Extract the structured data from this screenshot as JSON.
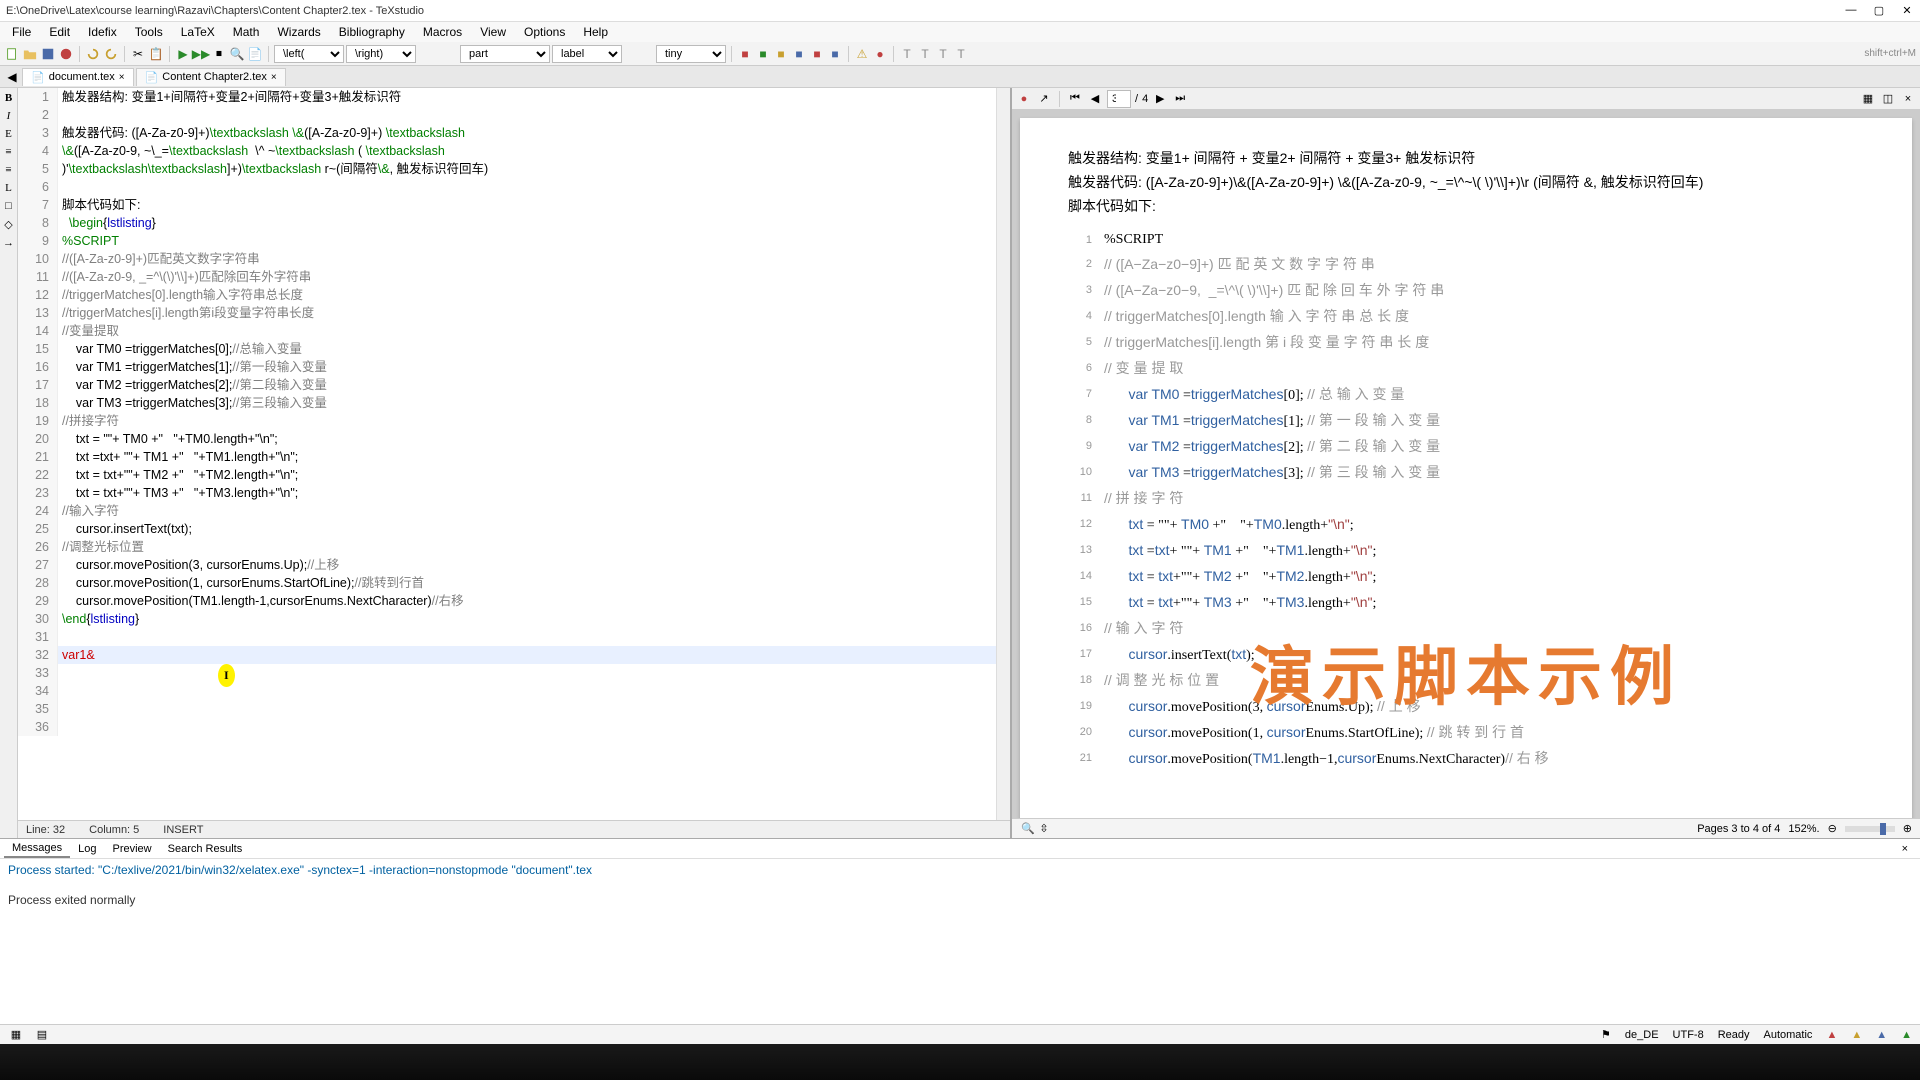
{
  "title": "E:\\OneDrive\\Latex\\course learning\\Razavi\\Chapters\\Content Chapter2.tex - TeXstudio",
  "menus": [
    "File",
    "Edit",
    "Idefix",
    "Tools",
    "LaTeX",
    "Math",
    "Wizards",
    "Bibliography",
    "Macros",
    "View",
    "Options",
    "Help"
  ],
  "combos": {
    "left": "\\left(",
    "right": "\\right)",
    "part": "part",
    "label": "label",
    "tiny": "tiny"
  },
  "tabs": [
    {
      "label": "document.tex"
    },
    {
      "label": "Content Chapter2.tex"
    }
  ],
  "side": [
    "B",
    "I",
    "E",
    "≡",
    "≡",
    "L",
    "□",
    "◇",
    "→"
  ],
  "lines": [
    {
      "n": 1,
      "t": "触发器结构: 变量1+间隔符+变量2+间隔符+变量3+触发标识符"
    },
    {
      "n": 2,
      "t": ""
    },
    {
      "n": 3,
      "t": "触发器代码: ([A-Za-z0-9]+)\\textbackslash \\&([A-Za-z0-9]+) \\textbackslash"
    },
    {
      "n": 4,
      "t": "\\&([A-Za-z0-9, ~\\_=\\textbackslash  \\^ ~\\textbackslash ( \\textbackslash"
    },
    {
      "n": 5,
      "t": ")'\\textbackslash\\textbackslash]+)\\textbackslash r~(间隔符\\&, 触发标识符回车)"
    },
    {
      "n": 6,
      "t": ""
    },
    {
      "n": 7,
      "t": "脚本代码如下:"
    },
    {
      "n": 8,
      "t": "  \\begin{lstlisting}",
      "env": true
    },
    {
      "n": 9,
      "t": "%SCRIPT",
      "c": "green"
    },
    {
      "n": 10,
      "t": "//([A-Za-z0-9]+)匹配英文数字字符串",
      "c": "gray"
    },
    {
      "n": 11,
      "t": "//([A-Za-z0-9, _=^\\(\\)'\\\\]+)匹配除回车外字符串",
      "c": "gray"
    },
    {
      "n": 12,
      "t": "//triggerMatches[0].length输入字符串总长度",
      "c": "gray"
    },
    {
      "n": 13,
      "t": "//triggerMatches[i].length第i段变量字符串长度",
      "c": "gray"
    },
    {
      "n": 14,
      "t": "//变量提取",
      "c": "gray"
    },
    {
      "n": 15,
      "t": "    var TM0 =triggerMatches[0];//总输入变量",
      "c": "mix"
    },
    {
      "n": 16,
      "t": "    var TM1 =triggerMatches[1];//第一段输入变量",
      "c": "mix"
    },
    {
      "n": 17,
      "t": "    var TM2 =triggerMatches[2];//第二段输入变量",
      "c": "mix"
    },
    {
      "n": 18,
      "t": "    var TM3 =triggerMatches[3];//第三段输入变量",
      "c": "mix"
    },
    {
      "n": 19,
      "t": "//拼接字符",
      "c": "gray"
    },
    {
      "n": 20,
      "t": "    txt = \"\"+ TM0 +\"   \"+TM0.length+\"\\n\";",
      "c": "mix"
    },
    {
      "n": 21,
      "t": "    txt =txt+ \"\"+ TM1 +\"   \"+TM1.length+\"\\n\";",
      "c": "mix"
    },
    {
      "n": 22,
      "t": "    txt = txt+\"\"+ TM2 +\"   \"+TM2.length+\"\\n\";",
      "c": "mix"
    },
    {
      "n": 23,
      "t": "    txt = txt+\"\"+ TM3 +\"   \"+TM3.length+\"\\n\";",
      "c": "mix"
    },
    {
      "n": 24,
      "t": "//输入字符",
      "c": "gray"
    },
    {
      "n": 25,
      "t": "    cursor.insertText(txt);",
      "c": "mix"
    },
    {
      "n": 26,
      "t": "//调整光标位置",
      "c": "gray"
    },
    {
      "n": 27,
      "t": "    cursor.movePosition(3, cursorEnums.Up);//上移",
      "c": "mix"
    },
    {
      "n": 28,
      "t": "    cursor.movePosition(1, cursorEnums.StartOfLine);//跳转到行首",
      "c": "mix"
    },
    {
      "n": 29,
      "t": "    cursor.movePosition(TM1.length-1,cursorEnums.NextCharacter)//右移",
      "c": "mix"
    },
    {
      "n": 30,
      "t": "\\end{lstlisting}",
      "env": true
    },
    {
      "n": 31,
      "t": ""
    },
    {
      "n": 32,
      "t": "var1&",
      "cur": true,
      "red": true
    },
    {
      "n": 33,
      "t": ""
    },
    {
      "n": 34,
      "t": ""
    },
    {
      "n": 35,
      "t": ""
    },
    {
      "n": 36,
      "t": ""
    }
  ],
  "status": {
    "line": "Line: 32",
    "col": "Column: 5",
    "mode": "INSERT"
  },
  "bptabs": [
    "Messages",
    "Log",
    "Preview",
    "Search Results"
  ],
  "bplog1": "Process started: \"C:/texlive/2021/bin/win32/xelatex.exe\" -synctex=1 -interaction=nonstopmode \"document\".tex",
  "bplog2": "Process exited normally",
  "pv": {
    "nav": {
      "cur": "3",
      "sep": "/",
      "tot": "4"
    },
    "header": [
      "触发器结构: 变量1+ 间隔符 + 变量2+ 间隔符 + 变量3+ 触发标识符",
      "触发器代码: ([A-Za-z0-9]+)\\&([A-Za-z0-9]+) \\&([A-Za-z0-9, ~_=\\^~\\( \\)'\\\\]+)\\r (间隔符 &, 触发标识符回车)",
      "脚本代码如下:"
    ],
    "plines": [
      {
        "n": 1,
        "t": "%SCRIPT"
      },
      {
        "n": 2,
        "t": "// ([A−Za−z0−9]+) 匹 配 英 文 数 字 字 符 串",
        "c": 1
      },
      {
        "n": 3,
        "t": "// ([A−Za−z0−9,  _=\\^\\( \\)'\\\\]+) 匹 配 除 回 车 外 字 符 串",
        "c": 1
      },
      {
        "n": 4,
        "t": "// triggerMatches[0].length 输 入 字 符 串 总 长 度",
        "c": 1
      },
      {
        "n": 5,
        "t": "// triggerMatches[i].length 第 i 段 变 量 字 符 串 长 度",
        "c": 1
      },
      {
        "n": 6,
        "t": "// 变 量 提 取",
        "c": 1
      },
      {
        "n": 7,
        "t": "       var TM0 =triggerMatches[0]; // 总 输 入 变 量"
      },
      {
        "n": 8,
        "t": "       var TM1 =triggerMatches[1]; // 第 一 段 输 入 变 量"
      },
      {
        "n": 9,
        "t": "       var TM2 =triggerMatches[2]; // 第 二 段 输 入 变 量"
      },
      {
        "n": 10,
        "t": "       var TM3 =triggerMatches[3]; // 第 三 段 输 入 变 量"
      },
      {
        "n": 11,
        "t": "// 拼 接 字 符",
        "c": 1
      },
      {
        "n": 12,
        "t": "       txt = \"\"+ TM0 +\"    \"+TM0.length+\"\\n\";"
      },
      {
        "n": 13,
        "t": "       txt =txt+ \"\"+ TM1 +\"    \"+TM1.length+\"\\n\";"
      },
      {
        "n": 14,
        "t": "       txt = txt+\"\"+ TM2 +\"    \"+TM2.length+\"\\n\";"
      },
      {
        "n": 15,
        "t": "       txt = txt+\"\"+ TM3 +\"    \"+TM3.length+\"\\n\";"
      },
      {
        "n": 16,
        "t": "// 输 入 字 符",
        "c": 1
      },
      {
        "n": 17,
        "t": "       cursor.insertText(txt);"
      },
      {
        "n": 18,
        "t": "// 调 整 光 标 位 置",
        "c": 1
      },
      {
        "n": 19,
        "t": "       cursor.movePosition(3, cursorEnums.Up); // 上 移"
      },
      {
        "n": 20,
        "t": "       cursor.movePosition(1, cursorEnums.StartOfLine); // 跳 转 到 行 首"
      },
      {
        "n": 21,
        "t": "       cursor.movePosition(TM1.length−1,cursorEnums.NextCharacter)// 右 移"
      }
    ],
    "bigtext": "演示脚本示例",
    "pages": "Pages 3 to 4 of 4",
    "zoom": "152%."
  },
  "appstatus": {
    "lang": "de_DE",
    "enc": "UTF-8",
    "ready": "Ready",
    "auto": "Automatic"
  }
}
